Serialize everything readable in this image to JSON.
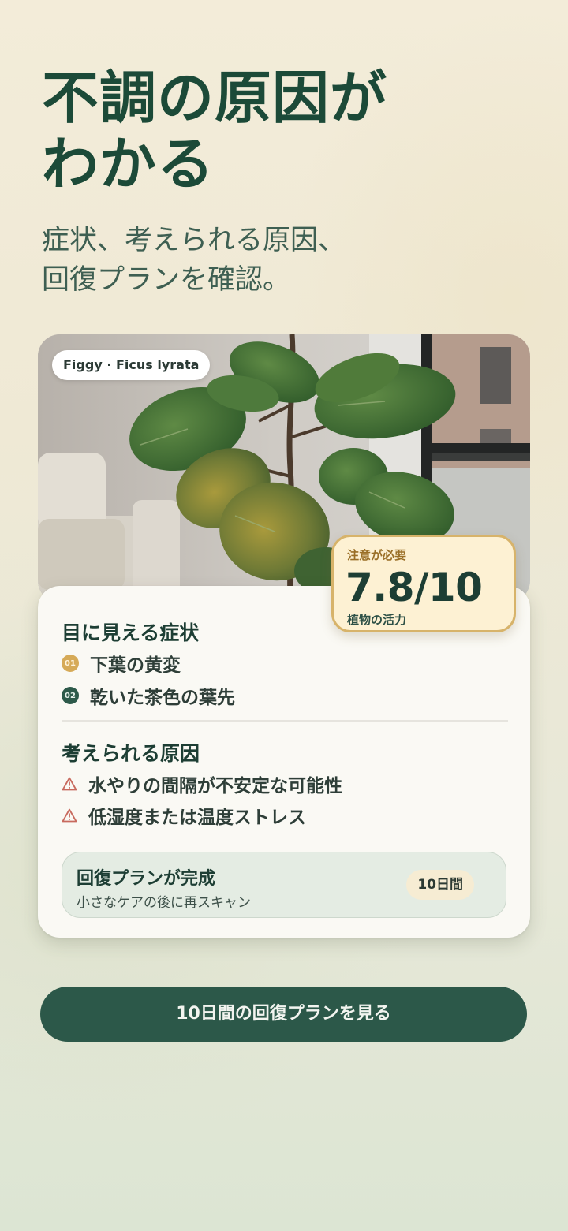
{
  "hero": {
    "title_line1": "不調の原因が",
    "title_line2": "わかる",
    "subtitle_line1": "症状、考えられる原因、",
    "subtitle_line2": "回復プランを確認。"
  },
  "plant_tag": "Figgy · Ficus lyrata",
  "score": {
    "status": "注意が必要",
    "value": "7.8/10",
    "caption": "植物の活力",
    "accent": "#d7b36a"
  },
  "symptoms": {
    "title": "目に見える症状",
    "items": [
      {
        "num": "01",
        "text": "下葉の黄変"
      },
      {
        "num": "02",
        "text": "乾いた茶色の葉先"
      }
    ]
  },
  "causes": {
    "title": "考えられる原因",
    "icon": "warning-icon",
    "items": [
      {
        "text": "水やりの間隔が不安定な可能性"
      },
      {
        "text": "低湿度または温度ストレス"
      }
    ]
  },
  "plan": {
    "title": "回復プランが完成",
    "subtitle": "小さなケアの後に再スキャン",
    "badge": "10日間"
  },
  "cta": {
    "label": "10日間の回復プランを見る",
    "color": "#2c5849"
  }
}
